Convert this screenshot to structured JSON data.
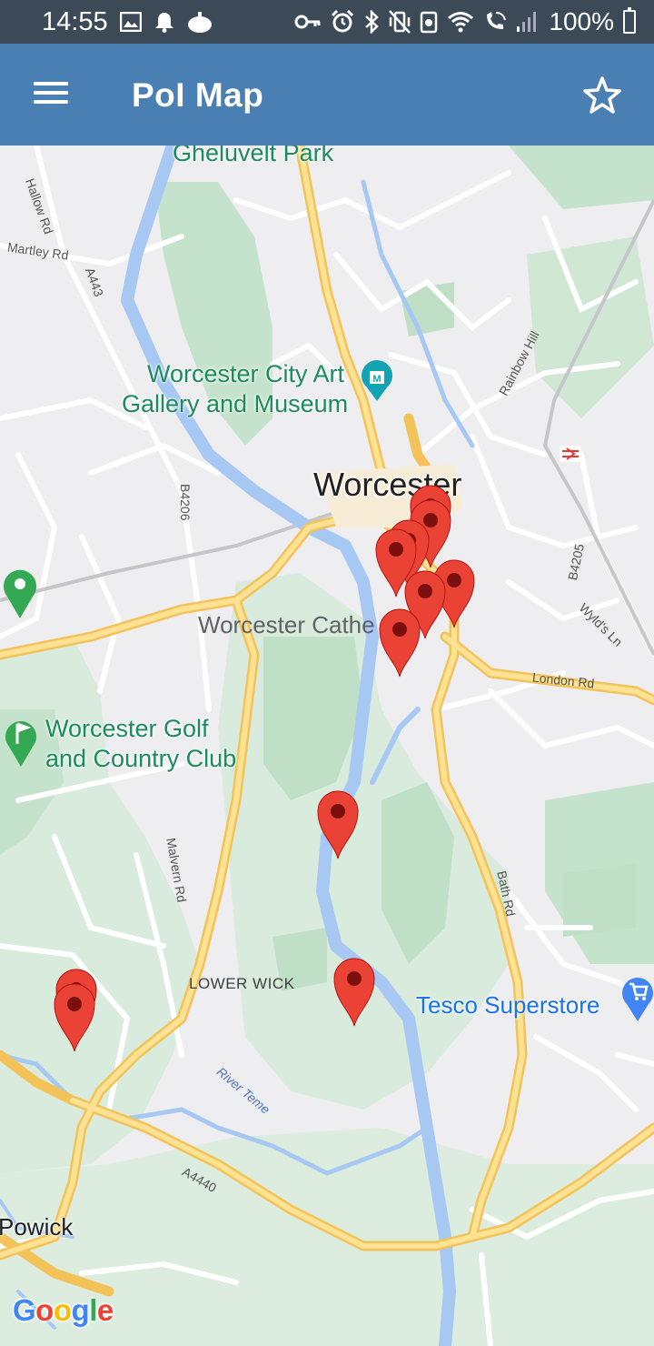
{
  "status_bar": {
    "time": "14:55",
    "battery": "100%",
    "left_icons": [
      "image-icon",
      "notification-bell-icon",
      "app-icon"
    ],
    "right_icons": [
      "key-icon",
      "alarm-icon",
      "bluetooth-icon",
      "mute-vibrate-icon",
      "data-saver-icon",
      "wifi-icon",
      "wifi-calling-icon",
      "signal-icon"
    ]
  },
  "app_bar": {
    "title": "PoI Map",
    "menu_icon": "hamburger-menu-icon",
    "action_icon": "star-outline-icon"
  },
  "map": {
    "places": {
      "gheluvelt": "Gheluvelt Park",
      "gallery_line1": "Worcester City Art",
      "gallery_line2": "Gallery and Museum",
      "city": "Worcester",
      "cathedral": "Worcester Cathe",
      "golf_line1": "Worcester Golf",
      "golf_line2": "and Country Club",
      "lower_wick": "LOWER WICK",
      "tesco": "Tesco Superstore",
      "powick": "Powick"
    },
    "roads": {
      "hallow": "Hallow Rd",
      "martley": "Martley Rd",
      "a443": "A443",
      "b4206": "B4206",
      "rainbow_hill": "Rainbow Hill",
      "b4205": "B4205",
      "wylds": "Wyld's Ln",
      "london": "London Rd",
      "malvern": "Malvern Rd",
      "bath": "Bath Rd",
      "a4440": "A4440",
      "river_teme": "River Teme"
    },
    "marker_color": "#ea4335",
    "marker_count": 11,
    "attribution": "Google"
  }
}
